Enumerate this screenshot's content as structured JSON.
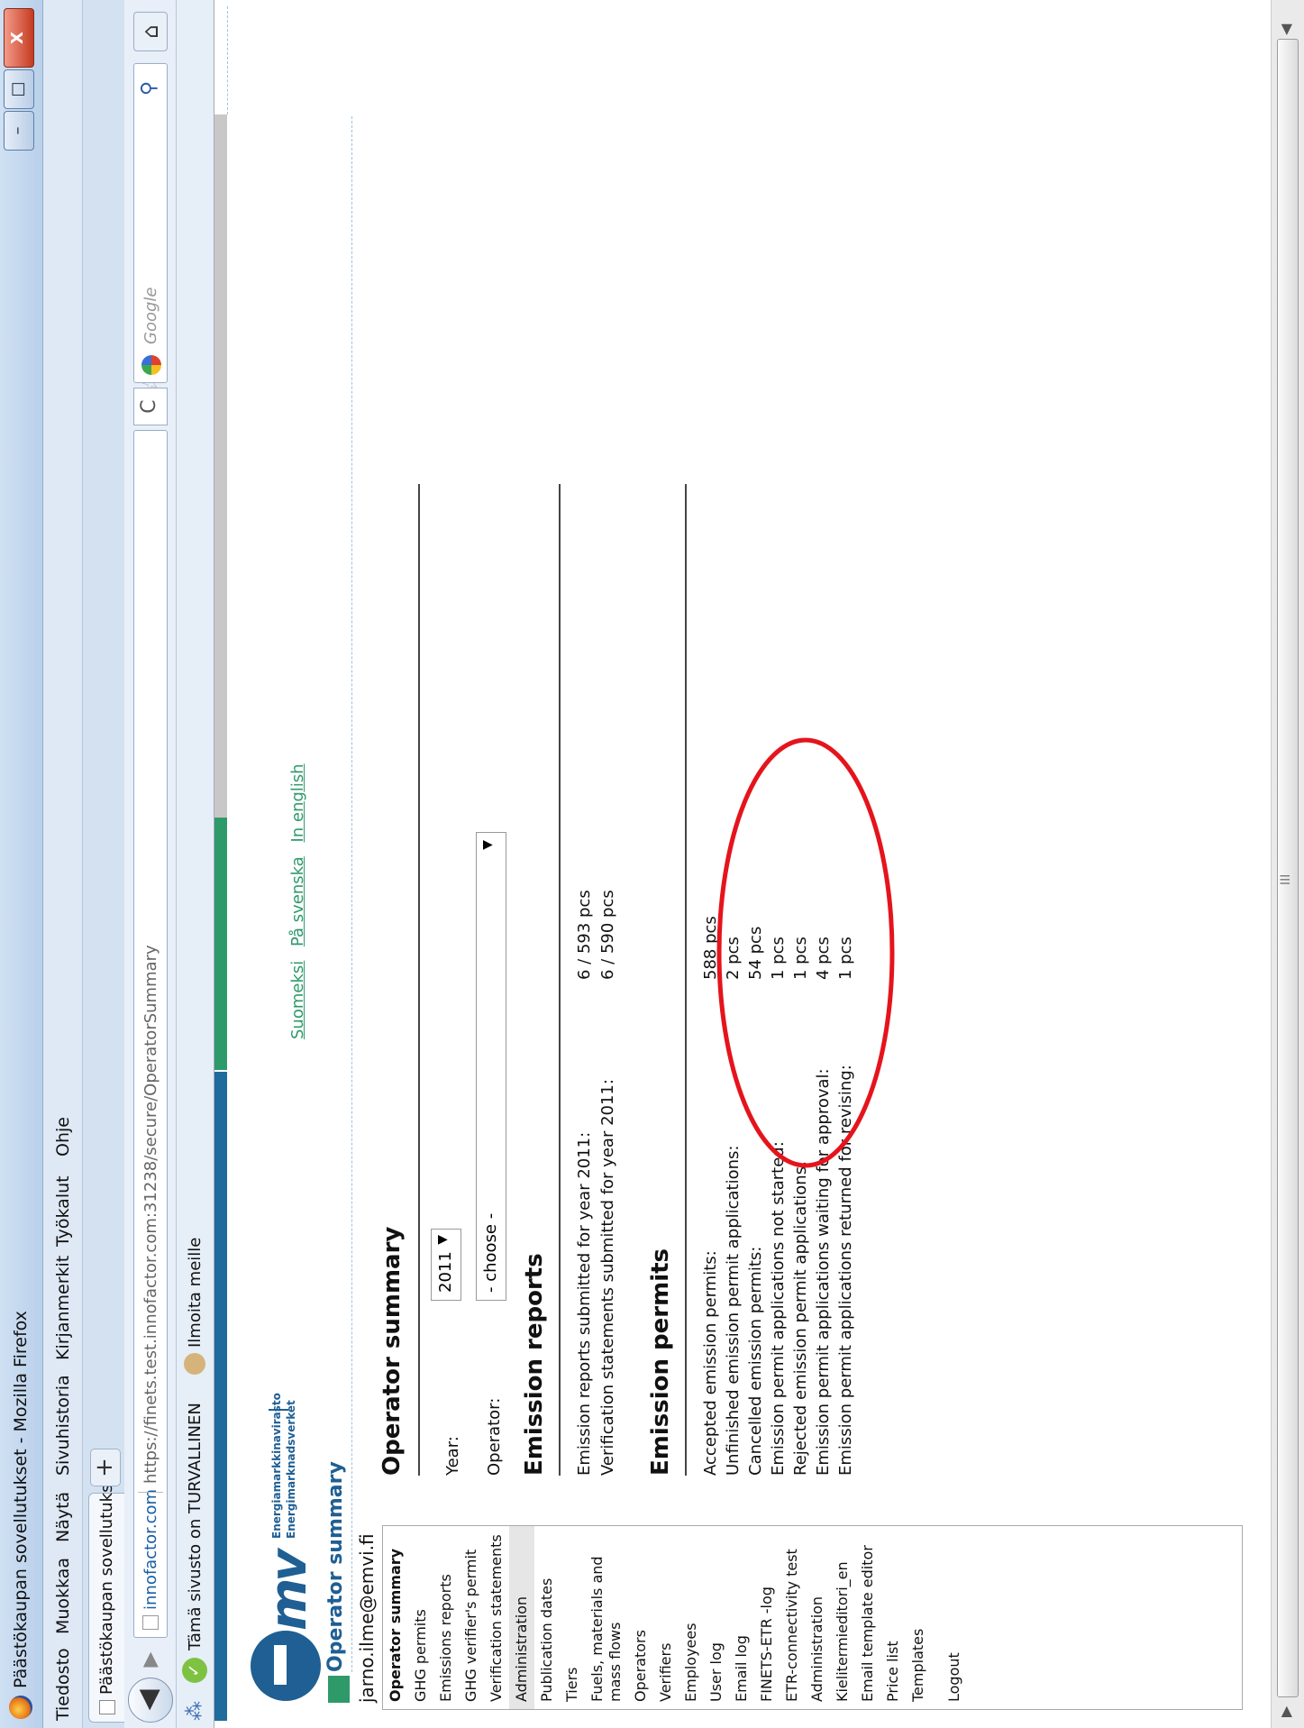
{
  "window": {
    "title": "Päästökaupan sovellutukset - Mozilla Firefox",
    "minimize": "–",
    "maximize": "□",
    "close": "X"
  },
  "menu": [
    {
      "label": "Tiedosto"
    },
    {
      "label": "Muokkaa"
    },
    {
      "label": "Näytä"
    },
    {
      "label": "Sivuhistoria"
    },
    {
      "label": "Kirjanmerkit"
    },
    {
      "label": "Työkalut"
    },
    {
      "label": "Ohje"
    }
  ],
  "tabs": [
    {
      "label": "Päästökaupan sovellutukset"
    }
  ],
  "newtab": "+",
  "nav": {
    "back": "◀",
    "forward": "▶",
    "site": "innofactor.com",
    "url": "https://finets.test.innofactor.com:31238/secure/OperatorSummary",
    "reload": "C",
    "search_placeholder": "Google",
    "home": "⌂"
  },
  "bookmarks": {
    "secure": "Tämä sivusto on TURVALLINEN",
    "report": "Ilmoita meille"
  },
  "logo": {
    "mv": "mv",
    "line1": "Energiamarkkinavirasto",
    "line2": "Energimarknadsverket"
  },
  "lang": [
    {
      "label": "Suomeksi"
    },
    {
      "label": "På svenska"
    },
    {
      "label": "In english"
    }
  ],
  "page_title": "Operator summary",
  "user": "jarno.ilme@emvi.fi",
  "sidebar": [
    {
      "label": "Operator summary",
      "active": true
    },
    {
      "label": "GHG permits"
    },
    {
      "label": "Emissions reports"
    },
    {
      "label": "GHG verifier's permit"
    },
    {
      "label": "Verification statements"
    },
    {
      "label": "Administration",
      "bg": true
    },
    {
      "label": "Publication dates"
    },
    {
      "label": "Tiers"
    },
    {
      "label": "Fuels, materials and mass flows"
    },
    {
      "label": "Operators"
    },
    {
      "label": "Verifiers"
    },
    {
      "label": "Employees"
    },
    {
      "label": "User log"
    },
    {
      "label": "Email log"
    },
    {
      "label": "FINETS-ETR -log"
    },
    {
      "label": "ETR-connectivity test"
    },
    {
      "label": "Administration"
    },
    {
      "label": "Kielitermieditori_en"
    },
    {
      "label": "Email template editor"
    },
    {
      "label": "Price list"
    },
    {
      "label": "Templates"
    },
    {
      "label": "Logout",
      "gap": true
    }
  ],
  "summary": {
    "heading": "Operator summary",
    "year_label": "Year:",
    "year_value": "2011",
    "operator_label": "Operator:",
    "operator_value": "- choose -"
  },
  "emission_reports": {
    "heading": "Emission reports",
    "rows": [
      {
        "label": "Emission reports submitted for year 2011:",
        "value": "6 / 593 pcs"
      },
      {
        "label": "Verification statements submitted for year 2011:",
        "value": "6 / 590 pcs"
      }
    ]
  },
  "emission_permits": {
    "heading": "Emission permits",
    "rows": [
      {
        "label": "Accepted emission permits:",
        "value": "588 pcs"
      },
      {
        "label": "Unfinished emission permit applications:",
        "value": "2 pcs"
      },
      {
        "label": "Cancelled emission permits:",
        "value": "54 pcs"
      },
      {
        "label": "Emission permit applications not started:",
        "value": "1 pcs"
      },
      {
        "label": "Rejected emission permit applications:",
        "value": "1 pcs"
      },
      {
        "label": "Emission permit applications waiting for approval:",
        "value": "4 pcs"
      },
      {
        "label": "Emission permit applications returned for revising:",
        "value": "1 pcs"
      }
    ]
  },
  "scrollbar": {
    "left": "◀",
    "right": "▶",
    "grip": "III"
  },
  "colors": {
    "annotation": "#e5141c",
    "brand": "#1f5f93",
    "green": "#2e9a6a"
  }
}
